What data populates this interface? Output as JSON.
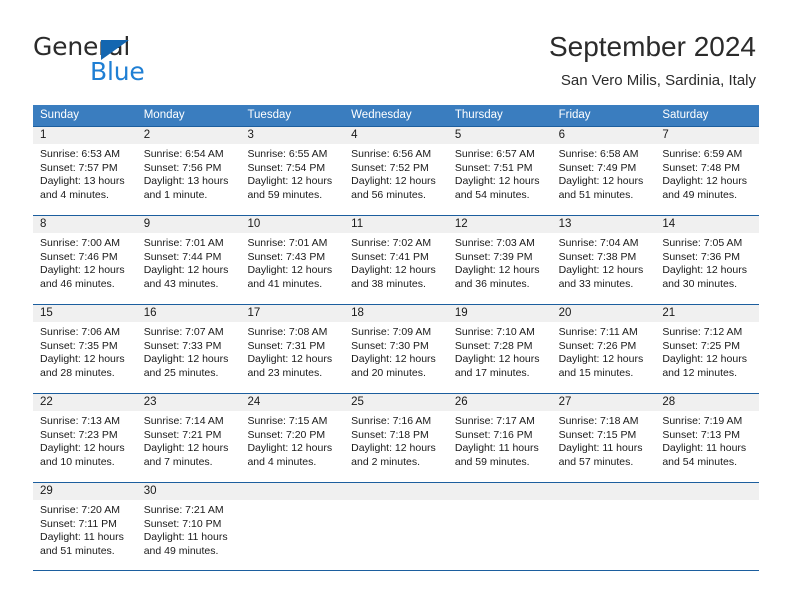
{
  "brand": {
    "word_one": "General",
    "word_two": "Blue",
    "flag_icon": "triangle-flag-icon"
  },
  "header": {
    "title": "September 2024",
    "location": "San Vero Milis, Sardinia, Italy"
  },
  "colors": {
    "header_blue": "#3a7dbf",
    "rule_blue": "#1c5e9e",
    "daynum_gray": "#f0f0f0",
    "brand_blue": "#1f7fd4",
    "brand_flag_blue": "#1466b0",
    "text": "#1a1a1a"
  },
  "weekdays": [
    "Sunday",
    "Monday",
    "Tuesday",
    "Wednesday",
    "Thursday",
    "Friday",
    "Saturday"
  ],
  "weeks": [
    [
      {
        "day": "1",
        "sunrise": "Sunrise: 6:53 AM",
        "sunset": "Sunset: 7:57 PM",
        "daylight_line1": "Daylight: 13 hours",
        "daylight_line2": "and 4 minutes."
      },
      {
        "day": "2",
        "sunrise": "Sunrise: 6:54 AM",
        "sunset": "Sunset: 7:56 PM",
        "daylight_line1": "Daylight: 13 hours",
        "daylight_line2": "and 1 minute."
      },
      {
        "day": "3",
        "sunrise": "Sunrise: 6:55 AM",
        "sunset": "Sunset: 7:54 PM",
        "daylight_line1": "Daylight: 12 hours",
        "daylight_line2": "and 59 minutes."
      },
      {
        "day": "4",
        "sunrise": "Sunrise: 6:56 AM",
        "sunset": "Sunset: 7:52 PM",
        "daylight_line1": "Daylight: 12 hours",
        "daylight_line2": "and 56 minutes."
      },
      {
        "day": "5",
        "sunrise": "Sunrise: 6:57 AM",
        "sunset": "Sunset: 7:51 PM",
        "daylight_line1": "Daylight: 12 hours",
        "daylight_line2": "and 54 minutes."
      },
      {
        "day": "6",
        "sunrise": "Sunrise: 6:58 AM",
        "sunset": "Sunset: 7:49 PM",
        "daylight_line1": "Daylight: 12 hours",
        "daylight_line2": "and 51 minutes."
      },
      {
        "day": "7",
        "sunrise": "Sunrise: 6:59 AM",
        "sunset": "Sunset: 7:48 PM",
        "daylight_line1": "Daylight: 12 hours",
        "daylight_line2": "and 49 minutes."
      }
    ],
    [
      {
        "day": "8",
        "sunrise": "Sunrise: 7:00 AM",
        "sunset": "Sunset: 7:46 PM",
        "daylight_line1": "Daylight: 12 hours",
        "daylight_line2": "and 46 minutes."
      },
      {
        "day": "9",
        "sunrise": "Sunrise: 7:01 AM",
        "sunset": "Sunset: 7:44 PM",
        "daylight_line1": "Daylight: 12 hours",
        "daylight_line2": "and 43 minutes."
      },
      {
        "day": "10",
        "sunrise": "Sunrise: 7:01 AM",
        "sunset": "Sunset: 7:43 PM",
        "daylight_line1": "Daylight: 12 hours",
        "daylight_line2": "and 41 minutes."
      },
      {
        "day": "11",
        "sunrise": "Sunrise: 7:02 AM",
        "sunset": "Sunset: 7:41 PM",
        "daylight_line1": "Daylight: 12 hours",
        "daylight_line2": "and 38 minutes."
      },
      {
        "day": "12",
        "sunrise": "Sunrise: 7:03 AM",
        "sunset": "Sunset: 7:39 PM",
        "daylight_line1": "Daylight: 12 hours",
        "daylight_line2": "and 36 minutes."
      },
      {
        "day": "13",
        "sunrise": "Sunrise: 7:04 AM",
        "sunset": "Sunset: 7:38 PM",
        "daylight_line1": "Daylight: 12 hours",
        "daylight_line2": "and 33 minutes."
      },
      {
        "day": "14",
        "sunrise": "Sunrise: 7:05 AM",
        "sunset": "Sunset: 7:36 PM",
        "daylight_line1": "Daylight: 12 hours",
        "daylight_line2": "and 30 minutes."
      }
    ],
    [
      {
        "day": "15",
        "sunrise": "Sunrise: 7:06 AM",
        "sunset": "Sunset: 7:35 PM",
        "daylight_line1": "Daylight: 12 hours",
        "daylight_line2": "and 28 minutes."
      },
      {
        "day": "16",
        "sunrise": "Sunrise: 7:07 AM",
        "sunset": "Sunset: 7:33 PM",
        "daylight_line1": "Daylight: 12 hours",
        "daylight_line2": "and 25 minutes."
      },
      {
        "day": "17",
        "sunrise": "Sunrise: 7:08 AM",
        "sunset": "Sunset: 7:31 PM",
        "daylight_line1": "Daylight: 12 hours",
        "daylight_line2": "and 23 minutes."
      },
      {
        "day": "18",
        "sunrise": "Sunrise: 7:09 AM",
        "sunset": "Sunset: 7:30 PM",
        "daylight_line1": "Daylight: 12 hours",
        "daylight_line2": "and 20 minutes."
      },
      {
        "day": "19",
        "sunrise": "Sunrise: 7:10 AM",
        "sunset": "Sunset: 7:28 PM",
        "daylight_line1": "Daylight: 12 hours",
        "daylight_line2": "and 17 minutes."
      },
      {
        "day": "20",
        "sunrise": "Sunrise: 7:11 AM",
        "sunset": "Sunset: 7:26 PM",
        "daylight_line1": "Daylight: 12 hours",
        "daylight_line2": "and 15 minutes."
      },
      {
        "day": "21",
        "sunrise": "Sunrise: 7:12 AM",
        "sunset": "Sunset: 7:25 PM",
        "daylight_line1": "Daylight: 12 hours",
        "daylight_line2": "and 12 minutes."
      }
    ],
    [
      {
        "day": "22",
        "sunrise": "Sunrise: 7:13 AM",
        "sunset": "Sunset: 7:23 PM",
        "daylight_line1": "Daylight: 12 hours",
        "daylight_line2": "and 10 minutes."
      },
      {
        "day": "23",
        "sunrise": "Sunrise: 7:14 AM",
        "sunset": "Sunset: 7:21 PM",
        "daylight_line1": "Daylight: 12 hours",
        "daylight_line2": "and 7 minutes."
      },
      {
        "day": "24",
        "sunrise": "Sunrise: 7:15 AM",
        "sunset": "Sunset: 7:20 PM",
        "daylight_line1": "Daylight: 12 hours",
        "daylight_line2": "and 4 minutes."
      },
      {
        "day": "25",
        "sunrise": "Sunrise: 7:16 AM",
        "sunset": "Sunset: 7:18 PM",
        "daylight_line1": "Daylight: 12 hours",
        "daylight_line2": "and 2 minutes."
      },
      {
        "day": "26",
        "sunrise": "Sunrise: 7:17 AM",
        "sunset": "Sunset: 7:16 PM",
        "daylight_line1": "Daylight: 11 hours",
        "daylight_line2": "and 59 minutes."
      },
      {
        "day": "27",
        "sunrise": "Sunrise: 7:18 AM",
        "sunset": "Sunset: 7:15 PM",
        "daylight_line1": "Daylight: 11 hours",
        "daylight_line2": "and 57 minutes."
      },
      {
        "day": "28",
        "sunrise": "Sunrise: 7:19 AM",
        "sunset": "Sunset: 7:13 PM",
        "daylight_line1": "Daylight: 11 hours",
        "daylight_line2": "and 54 minutes."
      }
    ],
    [
      {
        "day": "29",
        "sunrise": "Sunrise: 7:20 AM",
        "sunset": "Sunset: 7:11 PM",
        "daylight_line1": "Daylight: 11 hours",
        "daylight_line2": "and 51 minutes."
      },
      {
        "day": "30",
        "sunrise": "Sunrise: 7:21 AM",
        "sunset": "Sunset: 7:10 PM",
        "daylight_line1": "Daylight: 11 hours",
        "daylight_line2": "and 49 minutes."
      },
      {
        "day": "",
        "sunrise": "",
        "sunset": "",
        "daylight_line1": "",
        "daylight_line2": ""
      },
      {
        "day": "",
        "sunrise": "",
        "sunset": "",
        "daylight_line1": "",
        "daylight_line2": ""
      },
      {
        "day": "",
        "sunrise": "",
        "sunset": "",
        "daylight_line1": "",
        "daylight_line2": ""
      },
      {
        "day": "",
        "sunrise": "",
        "sunset": "",
        "daylight_line1": "",
        "daylight_line2": ""
      },
      {
        "day": "",
        "sunrise": "",
        "sunset": "",
        "daylight_line1": "",
        "daylight_line2": ""
      }
    ]
  ]
}
